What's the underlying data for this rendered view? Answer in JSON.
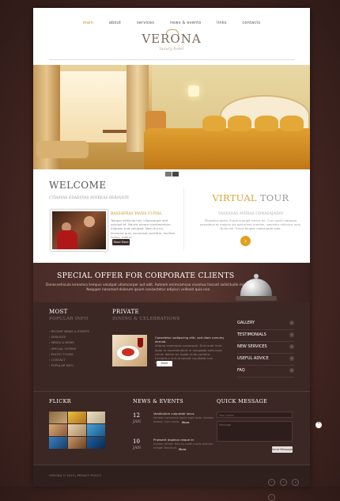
{
  "nav": {
    "items": [
      "main",
      "about",
      "services",
      "news & events",
      "links",
      "contacts"
    ],
    "active": 0
  },
  "brand": {
    "name": "VERONA",
    "tagline": "luxury hotel"
  },
  "slider": {
    "total": 2,
    "current": 0
  },
  "welcome": {
    "title": "WELCOME",
    "subtitle": "CTIASYAS EDAESYAS AVEREAS BERAVATE",
    "text_title": "BASSAFRAS YAVES CUIYAL",
    "text": "Tempor vehicula nisl, ullamcorper sed suscipit et. Mauris ornare condimentum. Aliquam erat volutpat. Nam dui mi, tincidunt quis, accumsan porttitor, facilisis luctus, metus.",
    "button": "Read More"
  },
  "tour": {
    "title_a": "VIRTUAL",
    "title_b": "TOUR",
    "subtitle": "VASEASAS AVERAS CDNASAJAIDO",
    "text": "Phasellus porta. Fusce suscipit varius mi. Cum sociis natoque penatibus et magnis dis parturient montes, nascetur ridiculus mus. Nulla dui. Fusce feugiat malesuada odio.",
    "arrow": "›"
  },
  "offer": {
    "title": "SPECIAL OFFER FOR CORPORATE CLIENTS",
    "text": "Donecvehicula loreamco tempus volutpat ullamcorper aut odit. Auteam enimcamcoo vivamus hacunt sollicitudin matris. Nequper nonsmod dolorum ipsum consectetur adipisci velitsed quia non."
  },
  "most": {
    "title": "MOST",
    "subtitle": "POPULAR INFO",
    "items": [
      "RECENT NEWS & EVENTS",
      "SERVICES",
      "MEDIA & NEWS",
      "SPECIAL OFFERS",
      "PHOTO TOURS",
      "CONTACT",
      "POPULAR INFO"
    ]
  },
  "private": {
    "title": "PRIVATE",
    "subtitle": "DINING & CELEBRATIONS",
    "highlight": "Consetetur sadipscing elitr, sed diam nonumy eirmod.",
    "text": "Aliquip commodo consequat. Duis aute irure dolor in reprehenderit in voluptate velit esse cillum dolore eu fugiat nulla pariatur. Excepteur sint occaecat cupidatat non proident.",
    "button": "More"
  },
  "links": {
    "items": [
      "GALLERY",
      "TESTIMONIALS",
      "NEW SERVICES",
      "USEFUL ADVICE",
      "FAQ"
    ]
  },
  "flickr": {
    "title": "FLICKR"
  },
  "news": {
    "title": "NEWS & EVENTS",
    "items": [
      {
        "day": "12",
        "month": "JAN",
        "title": "Vestibulum vulputate lacus",
        "text": "Aenean commodo ligula eget dolor. Aenean massa. Cum sociis",
        "more": "More"
      },
      {
        "day": "10",
        "month": "JAN",
        "title": "Praesent dapibus neque id",
        "text": "Nullam dictum felis eu pede mollis pretium. Integer tincidunt.",
        "more": "More"
      }
    ]
  },
  "quick": {
    "title": "QUICK MESSAGE",
    "name_placeholder": "Your name",
    "message_placeholder": "Message",
    "button": "Send Message"
  },
  "footer": {
    "text": "VERONA © 2013  |  PRIVACY POLICY",
    "social": [
      "f",
      "t",
      "g",
      "r"
    ]
  },
  "colors": {
    "accent": "#d9a43a",
    "dark": "#3b2824",
    "offer": "#4a2c28"
  },
  "icons": {
    "arrow": "right-arrow-icon",
    "chevron": "chevron-right-icon",
    "scroll": "scroll-up-icon"
  }
}
